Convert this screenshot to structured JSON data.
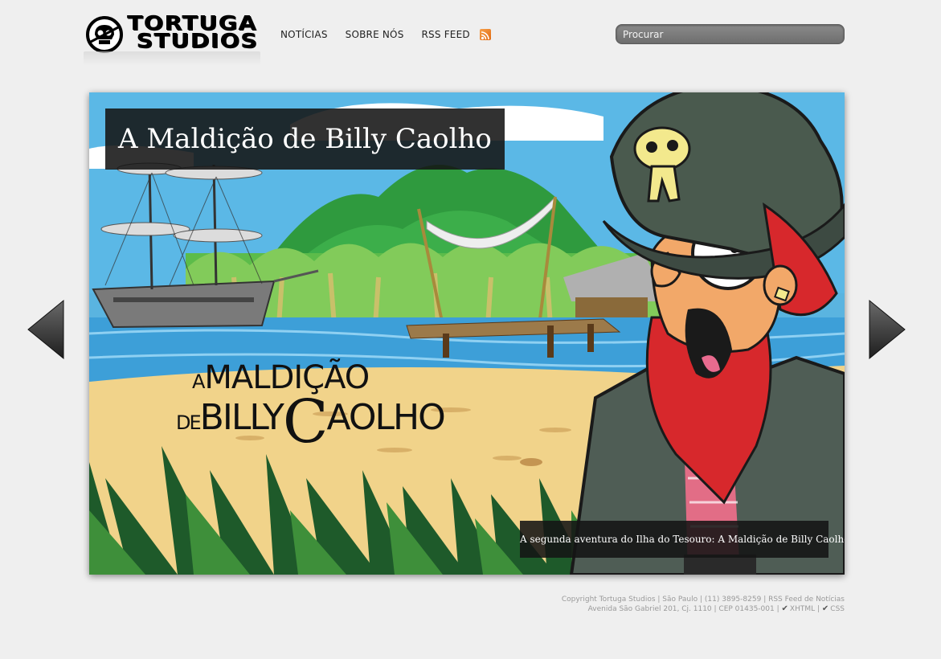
{
  "brand": {
    "line1": "TORTUGA",
    "line2": "STUDIOS"
  },
  "nav": {
    "items": [
      "NOTÍCIAS",
      "SOBRE NÓS",
      "RSS FEED"
    ],
    "rss_icon": "rss-icon"
  },
  "search": {
    "placeholder": "Procurar"
  },
  "slide": {
    "title": "A Maldição de Billy Caolho",
    "caption": "A segunda aventura do Ilha do Tesouro: A Maldição de Billy Caolho",
    "art_title": {
      "a": "A",
      "line1": "MALDIÇÃO",
      "de": "DE",
      "billy": "BILLY",
      "c": "C",
      "aolho": "AOLHO"
    }
  },
  "footer": {
    "line1": {
      "copyright": "Copyright Tortuga Studios",
      "city": "São Paulo",
      "phone": "(11) 3895-8259",
      "rss": "RSS Feed de Notícias"
    },
    "line2": {
      "address": "Avenida São Gabriel 201, Cj. 1110",
      "cep": "CEP 01435-001",
      "xhtml": "XHTML",
      "css": "CSS"
    }
  },
  "colors": {
    "background": "#efefef",
    "overlay": "#141414",
    "rss": "#e8812a"
  }
}
